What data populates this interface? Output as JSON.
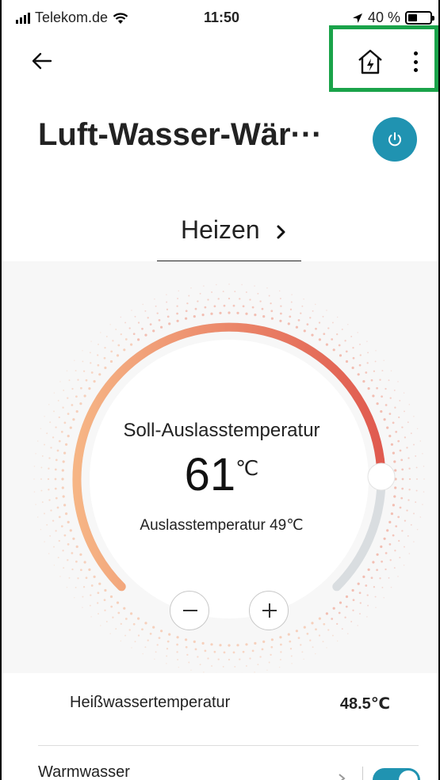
{
  "status_bar": {
    "carrier": "Telekom.de",
    "time": "11:50",
    "battery": "40 %",
    "battery_level": 0.4
  },
  "header": {
    "back_icon": "arrow-left-icon",
    "home_icon": "home-power-icon",
    "more_icon": "more-vertical-icon"
  },
  "device": {
    "title": "Luft-Wasser-Wär···",
    "power_icon": "power-icon",
    "power_color": "#2093b1"
  },
  "mode": {
    "label": "Heizen",
    "chevron_icon": "chevron-right-icon"
  },
  "dial": {
    "setpoint_label": "Soll-Auslasstemperatur",
    "setpoint_value": "61",
    "setpoint_unit": "℃",
    "outlet_label": "Auslasstemperatur 49℃",
    "level": 0.83,
    "gradient_start": "#f6b585",
    "gradient_end": "#e05a4f",
    "track_color": "#d9dde0"
  },
  "controls": {
    "minus_icon": "minus-icon",
    "plus_icon": "plus-icon"
  },
  "hot_water": {
    "label": "Heißwassertemperatur",
    "value": "48.5℃"
  },
  "warm_water": {
    "label": "Warmwasser",
    "toggle_on": true
  },
  "colors": {
    "highlight": "#1aa34a",
    "accent": "#2093b1"
  }
}
